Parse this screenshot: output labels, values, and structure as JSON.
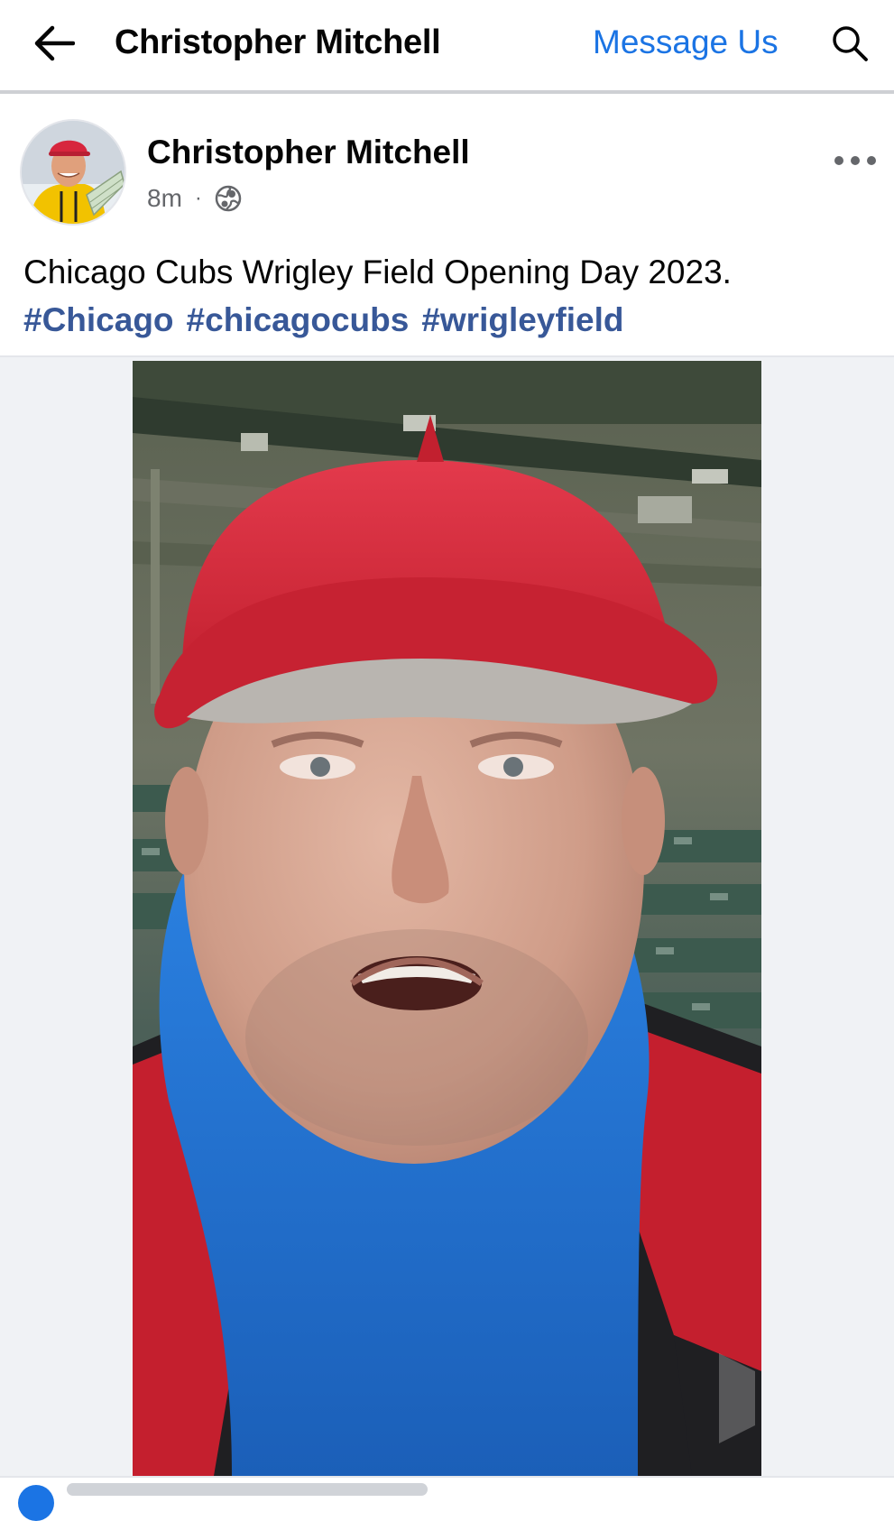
{
  "nav": {
    "back_icon": "arrow-left-icon",
    "title": "Christopher Mitchell",
    "message_label": "Message Us",
    "search_icon": "search-icon"
  },
  "post": {
    "author": "Christopher Mitchell",
    "time": "8m",
    "separator": "·",
    "privacy_icon": "globe-icon",
    "more_icon": "more-options-icon",
    "text": "Chicago Cubs Wrigley Field Opening Day 2023.",
    "hashtags": [
      "#Chicago",
      "#chicagocubs",
      "#wrigleyfield"
    ]
  },
  "colors": {
    "link_blue": "#1b74e4",
    "hashtag_blue": "#385898",
    "secondary_text": "#65676b",
    "cap_red": "#d7263d",
    "hoodie_blue": "#1f73d6"
  }
}
